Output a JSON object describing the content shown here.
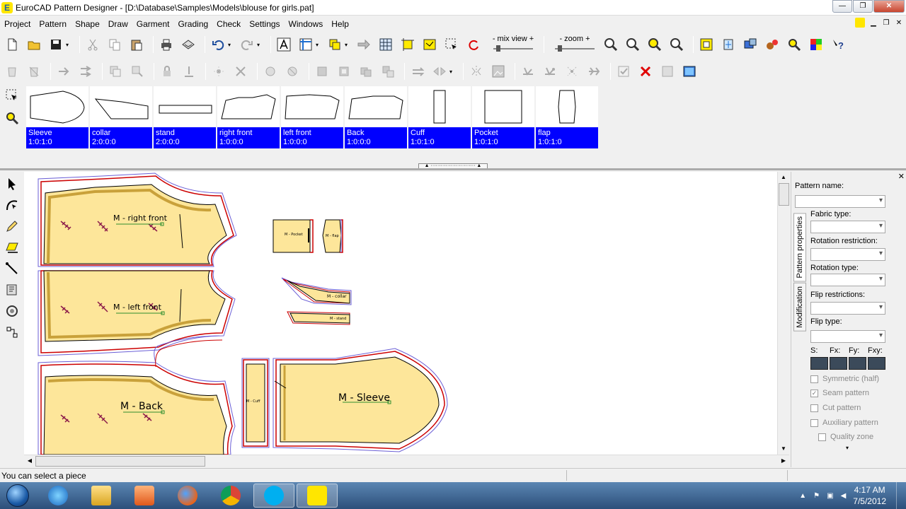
{
  "window": {
    "title": "EuroCAD Pattern Designer - [D:\\Database\\Samples\\Models\\blouse for girls.pat]",
    "app_icon": "E",
    "minimize": "—",
    "restore": "❐",
    "close": "✕"
  },
  "menu": [
    "Project",
    "Pattern",
    "Shape",
    "Draw",
    "Garment",
    "Grading",
    "Check",
    "Settings",
    "Windows",
    "Help"
  ],
  "toolbar": {
    "mix_view_label": "- mix view +",
    "zoom_label": "-  zoom  +"
  },
  "pieces": [
    {
      "name": "Sleeve",
      "code": "1:0:1:0"
    },
    {
      "name": "collar",
      "code": "2:0:0:0"
    },
    {
      "name": "stand",
      "code": "2:0:0:0"
    },
    {
      "name": "right front",
      "code": "1:0:0:0"
    },
    {
      "name": "left front",
      "code": "1:0:0:0"
    },
    {
      "name": "Back",
      "code": "1:0:0:0"
    },
    {
      "name": "Cuff",
      "code": "1:0:1:0"
    },
    {
      "name": "Pocket",
      "code": "1:0:1:0"
    },
    {
      "name": "flap",
      "code": "1:0:1:0"
    }
  ],
  "canvas_labels": {
    "right_front": "M - right front",
    "left_front": "M - left front",
    "back": "M - Back",
    "sleeve": "M - Sleeve",
    "pocket": "M - Pocket",
    "flap": "M - flap",
    "collar": "M - collar",
    "stand": "M - stand",
    "cuff": "M - Cuff"
  },
  "properties": {
    "pattern_name_label": "Pattern name:",
    "tabs": [
      "Pattern properties",
      "Modification"
    ],
    "fabric_type_label": "Fabric type:",
    "rotation_restriction_label": "Rotation restriction:",
    "rotation_type_label": "Rotation type:",
    "flip_restrictions_label": "Flip restrictions:",
    "flip_type_label": "Flip type:",
    "scale_headers": [
      "S:",
      "Fx:",
      "Fy:",
      "Fxy:"
    ],
    "checkboxes": [
      {
        "label": "Symmetric (half)",
        "checked": false
      },
      {
        "label": "Seam pattern",
        "checked": true
      },
      {
        "label": "Cut pattern",
        "checked": false
      },
      {
        "label": "Auxiliary pattern",
        "checked": false
      },
      {
        "label": "Quality zone",
        "checked": false
      }
    ]
  },
  "status": {
    "message": "You can select a piece"
  },
  "taskbar": {
    "time": "4:17 AM",
    "date": "7/5/2012"
  },
  "colors": {
    "piece_fill": "#fde69a",
    "piece_label_bg": "#0000ff",
    "seam_outline": "#cc0000",
    "grade_lines": "#6b5fd6"
  }
}
